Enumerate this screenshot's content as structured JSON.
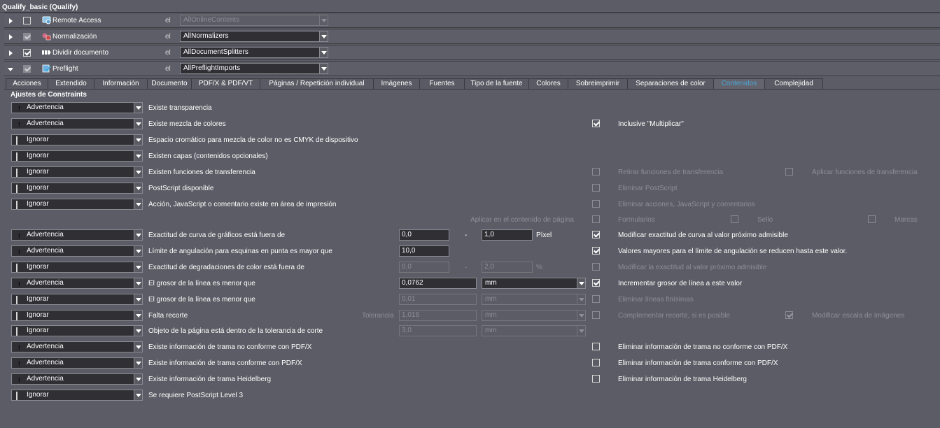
{
  "header": {
    "title": "Qualify_basic (Qualify)"
  },
  "sequence": [
    {
      "name": "Remote Access",
      "el": "el",
      "value": "AllOnlineContents",
      "checked": false,
      "disabled": true,
      "icon": "remote-access-icon"
    },
    {
      "name": "Normalización",
      "el": "el",
      "value": "AllNormalizers",
      "checked": true,
      "disabled": false,
      "cbgrey": true,
      "icon": "normalization-icon"
    },
    {
      "name": "Dividir documento",
      "el": "el",
      "value": "AllDocumentSplitters",
      "checked": true,
      "disabled": false,
      "icon": "split-document-icon"
    },
    {
      "name": "Preflight",
      "el": "el",
      "value": "AllPreflightImports",
      "checked": true,
      "disabled": false,
      "cbgrey": true,
      "expanded": true,
      "icon": "preflight-icon"
    }
  ],
  "tabs": [
    "Acciones",
    "Extendido",
    "Información",
    "Documento",
    "PDF/X & PDF/VT",
    "Páginas / Repetición individual",
    "Imágenes",
    "Fuentes",
    "Tipo de la fuente",
    "Colores",
    "Sobreimprimir",
    "Separaciones de color",
    "Contenidos",
    "Complejidad"
  ],
  "active_tab": "Contenidos",
  "section_title": "Ajustes de Constraints",
  "status_options": {
    "warn": "Advertencia",
    "ignore": "Ignorar"
  },
  "rows": [
    {
      "status": "warn",
      "label": "Existe transparencia"
    },
    {
      "status": "warn",
      "label": "Existe mezcla de colores",
      "opt1": {
        "label": "Inclusive \"Multiplicar\"",
        "checked": true
      }
    },
    {
      "status": "ignore",
      "label": "Espacio cromático para mezcla de color no es CMYK de dispositivo"
    },
    {
      "status": "ignore",
      "label": "Existen capas (contenidos opcionales)"
    },
    {
      "status": "ignore",
      "label": "Existen funciones de transferencia",
      "opt1": {
        "label": "Retirar funciones de transferencia",
        "checked": false,
        "disabled": true
      },
      "opt2": {
        "label": "Aplicar funciones de transferencia",
        "checked": false,
        "disabled": true
      }
    },
    {
      "status": "ignore",
      "label": "PostScript disponible",
      "opt1": {
        "label": "Eliminar PostScript",
        "checked": false,
        "disabled": true
      }
    },
    {
      "status": "ignore",
      "label": "Acción, JavaScript o comentario existe en área de impresión",
      "opt1": {
        "label": "Eliminar acciones, JavaScript y comentarios",
        "checked": false,
        "disabled": true
      }
    },
    {
      "status": null,
      "apply_label": "Aplicar en el contenido de página",
      "opt1": {
        "label": "Formularios",
        "checked": false,
        "disabled": true
      },
      "opt2": {
        "label": "Sello",
        "checked": false,
        "disabled": true
      },
      "opt3": {
        "label": "Marcas",
        "checked": false,
        "disabled": true
      }
    },
    {
      "status": "warn",
      "label": "Exactitud de curva de gráficos está fuera de",
      "v1": "0,0",
      "dash": "-",
      "v2": "1,0",
      "unit": "Píxel",
      "opt1": {
        "label": "Modificar exactitud de curva al valor próximo admisible",
        "checked": true
      }
    },
    {
      "status": "warn",
      "label": "Límite de angulación para esquinas en punta es mayor que",
      "v1": "10,0",
      "opt1": {
        "label": "Valores mayores para el límite de angulación se reducen hasta este valor.",
        "checked": true
      }
    },
    {
      "status": "ignore",
      "label": "Exactitud de degradaciones de color está fuera de",
      "v1": "0,0",
      "dash": "-",
      "v2": "2,0",
      "unit": "%",
      "disabled": true,
      "opt1": {
        "label": "Modificar la exactitud al valor próximo admisible",
        "checked": false,
        "disabled": true
      }
    },
    {
      "status": "warn",
      "label": "El grosor de la línea es menor que",
      "w1": "0,0762",
      "sel": "mm",
      "opt1": {
        "label": "Incrementar grosor de línea a este valor",
        "checked": true
      }
    },
    {
      "status": "ignore",
      "label": "El grosor de la línea es menor que",
      "w1": "0,01",
      "sel": "mm",
      "disabled": true,
      "opt1": {
        "label": "Eliminar líneas finísimas",
        "checked": false,
        "disabled": true
      }
    },
    {
      "status": "ignore",
      "label": "Falta recorte",
      "tol": "Tolerancia",
      "w1": "1,016",
      "sel": "mm",
      "disabled": true,
      "opt1": {
        "label": "Complementar recorte, si es posible",
        "checked": false,
        "disabled": true
      },
      "opt2": {
        "label": "Modificar escala de imágenes",
        "checked": true,
        "disabled": true
      }
    },
    {
      "status": "ignore",
      "label": "Objeto de la página está dentro de la tolerancia de corte",
      "w1": "3,0",
      "sel": "mm",
      "disabled": true
    },
    {
      "status": "warn",
      "label": "Existe información de trama no conforme con PDF/X",
      "opt1": {
        "label": "Eliminar información de trama no conforme con PDF/X",
        "checked": false
      }
    },
    {
      "status": "warn",
      "label": "Existe información de trama conforme con PDF/X",
      "opt1": {
        "label": "Eliminar información de trama conforme con PDF/X",
        "checked": false
      }
    },
    {
      "status": "warn",
      "label": "Existe información de trama Heidelberg",
      "opt1": {
        "label": "Eliminar información de trama Heidelberg",
        "checked": false
      }
    },
    {
      "status": "ignore",
      "label": "Se requiere PostScript Level 3"
    }
  ]
}
